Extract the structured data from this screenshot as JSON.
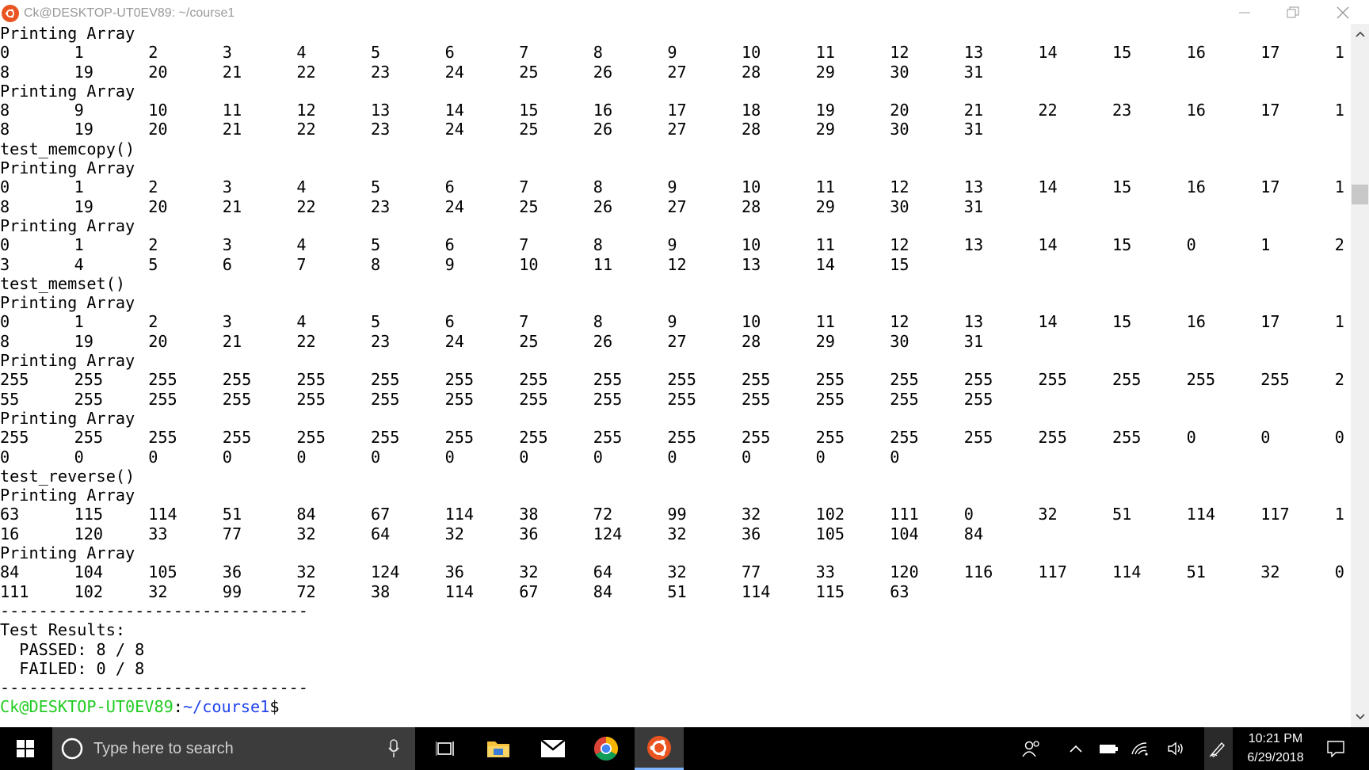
{
  "window": {
    "title": "Ck@DESKTOP-UT0EV89: ~/course1"
  },
  "terminal": {
    "lines": [
      {
        "t": "Printing Array"
      },
      {
        "c": [
          "0",
          "1",
          "2",
          "3",
          "4",
          "5",
          "6",
          "7",
          "8",
          "9",
          "10",
          "11",
          "12",
          "13",
          "14",
          "15",
          "16",
          "17",
          "1"
        ]
      },
      {
        "c": [
          "8",
          "19",
          "20",
          "21",
          "22",
          "23",
          "24",
          "25",
          "26",
          "27",
          "28",
          "29",
          "30",
          "31"
        ]
      },
      {
        "t": "Printing Array"
      },
      {
        "c": [
          "8",
          "9",
          "10",
          "11",
          "12",
          "13",
          "14",
          "15",
          "16",
          "17",
          "18",
          "19",
          "20",
          "21",
          "22",
          "23",
          "16",
          "17",
          "1"
        ]
      },
      {
        "c": [
          "8",
          "19",
          "20",
          "21",
          "22",
          "23",
          "24",
          "25",
          "26",
          "27",
          "28",
          "29",
          "30",
          "31"
        ]
      },
      {
        "t": "test_memcopy()"
      },
      {
        "t": "Printing Array"
      },
      {
        "c": [
          "0",
          "1",
          "2",
          "3",
          "4",
          "5",
          "6",
          "7",
          "8",
          "9",
          "10",
          "11",
          "12",
          "13",
          "14",
          "15",
          "16",
          "17",
          "1"
        ]
      },
      {
        "c": [
          "8",
          "19",
          "20",
          "21",
          "22",
          "23",
          "24",
          "25",
          "26",
          "27",
          "28",
          "29",
          "30",
          "31"
        ]
      },
      {
        "t": "Printing Array"
      },
      {
        "c": [
          "0",
          "1",
          "2",
          "3",
          "4",
          "5",
          "6",
          "7",
          "8",
          "9",
          "10",
          "11",
          "12",
          "13",
          "14",
          "15",
          "0",
          "1",
          "2"
        ]
      },
      {
        "c": [
          "3",
          "4",
          "5",
          "6",
          "7",
          "8",
          "9",
          "10",
          "11",
          "12",
          "13",
          "14",
          "15"
        ]
      },
      {
        "t": "test_memset()"
      },
      {
        "t": "Printing Array"
      },
      {
        "c": [
          "0",
          "1",
          "2",
          "3",
          "4",
          "5",
          "6",
          "7",
          "8",
          "9",
          "10",
          "11",
          "12",
          "13",
          "14",
          "15",
          "16",
          "17",
          "1"
        ]
      },
      {
        "c": [
          "8",
          "19",
          "20",
          "21",
          "22",
          "23",
          "24",
          "25",
          "26",
          "27",
          "28",
          "29",
          "30",
          "31"
        ]
      },
      {
        "t": "Printing Array"
      },
      {
        "c": [
          "255",
          "255",
          "255",
          "255",
          "255",
          "255",
          "255",
          "255",
          "255",
          "255",
          "255",
          "255",
          "255",
          "255",
          "255",
          "255",
          "255",
          "255",
          "2"
        ]
      },
      {
        "c": [
          "55",
          "255",
          "255",
          "255",
          "255",
          "255",
          "255",
          "255",
          "255",
          "255",
          "255",
          "255",
          "255",
          "255"
        ]
      },
      {
        "t": "Printing Array"
      },
      {
        "c": [
          "255",
          "255",
          "255",
          "255",
          "255",
          "255",
          "255",
          "255",
          "255",
          "255",
          "255",
          "255",
          "255",
          "255",
          "255",
          "255",
          "0",
          "0",
          "0"
        ]
      },
      {
        "c": [
          "0",
          "0",
          "0",
          "0",
          "0",
          "0",
          "0",
          "0",
          "0",
          "0",
          "0",
          "0",
          "0"
        ]
      },
      {
        "t": "test_reverse()"
      },
      {
        "t": "Printing Array"
      },
      {
        "c": [
          "63",
          "115",
          "114",
          "51",
          "84",
          "67",
          "114",
          "38",
          "72",
          "99",
          "32",
          "102",
          "111",
          "0",
          "32",
          "51",
          "114",
          "117",
          "1"
        ]
      },
      {
        "c": [
          "16",
          "120",
          "33",
          "77",
          "32",
          "64",
          "32",
          "36",
          "124",
          "32",
          "36",
          "105",
          "104",
          "84"
        ]
      },
      {
        "t": "Printing Array"
      },
      {
        "c": [
          "84",
          "104",
          "105",
          "36",
          "32",
          "124",
          "36",
          "32",
          "64",
          "32",
          "77",
          "33",
          "120",
          "116",
          "117",
          "114",
          "51",
          "32",
          "0"
        ]
      },
      {
        "c": [
          "111",
          "102",
          "32",
          "99",
          "72",
          "38",
          "114",
          "67",
          "84",
          "51",
          "114",
          "115",
          "63"
        ]
      },
      {
        "t": "--------------------------------"
      },
      {
        "t": "Test Results:"
      },
      {
        "t": "  PASSED: 8 / 8"
      },
      {
        "t": "  FAILED: 0 / 8"
      },
      {
        "t": "--------------------------------"
      }
    ],
    "prompt": {
      "user": "Ck@DESKTOP-UT0EV89",
      "sep": ":",
      "path": "~/course1",
      "symbol": "$"
    }
  },
  "taskbar": {
    "search_placeholder": "Type here to search",
    "time": "10:21 PM",
    "date": "6/29/2018",
    "apps": [
      "task-view",
      "file-explorer",
      "mail",
      "chrome",
      "ubuntu"
    ]
  },
  "colors": {
    "prompt_user": "#22cc22",
    "prompt_path": "#2244ee",
    "ubuntu_orange": "#e95420",
    "taskbar_bg": "#000000"
  }
}
